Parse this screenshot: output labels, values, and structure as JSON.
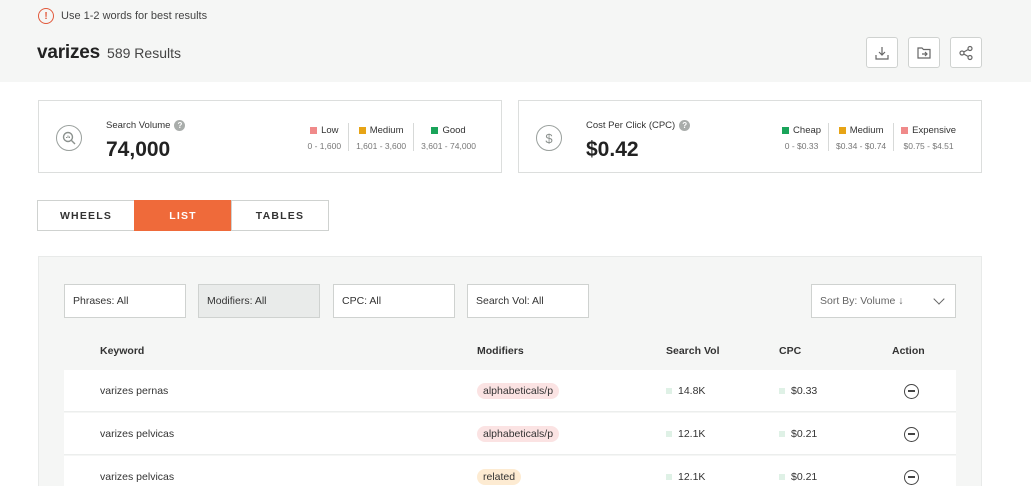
{
  "hint": {
    "text": "Use 1-2 words for best results"
  },
  "header": {
    "keyword": "varizes",
    "results": "589 Results"
  },
  "toolbar": {
    "download": "download-icon",
    "save": "folder-icon",
    "share": "share-icon"
  },
  "cards": {
    "search_volume": {
      "label": "Search Volume",
      "value": "74,000",
      "legend": [
        {
          "name": "Low",
          "range": "0 - 1,600",
          "color": "#f08a8a"
        },
        {
          "name": "Medium",
          "range": "1,601 - 3,600",
          "color": "#e7a416"
        },
        {
          "name": "Good",
          "range": "3,601 - 74,000",
          "color": "#1aa45a"
        }
      ]
    },
    "cpc": {
      "label": "Cost Per Click (CPC)",
      "value": "$0.42",
      "legend": [
        {
          "name": "Cheap",
          "range": "0 - $0.33",
          "color": "#1aa45a"
        },
        {
          "name": "Medium",
          "range": "$0.34 - $0.74",
          "color": "#e7a416"
        },
        {
          "name": "Expensive",
          "range": "$0.75 - $4.51",
          "color": "#f08a8a"
        }
      ]
    }
  },
  "view_tabs": [
    "WHEELS",
    "LIST",
    "TABLES"
  ],
  "filters": {
    "phrases": "Phrases: All",
    "modifiers": "Modifiers: All",
    "cpc": "CPC: All",
    "search_vol": "Search Vol: All",
    "sort": "Sort By: Volume ↓"
  },
  "table": {
    "headers": [
      "Keyword",
      "Modifiers",
      "Search Vol",
      "CPC",
      "Action"
    ],
    "rows": [
      {
        "keyword": "varizes pernas",
        "modifier": "alphabeticals/p",
        "search_vol": "14.8K",
        "cpc": "$0.33"
      },
      {
        "keyword": "varizes pelvicas",
        "modifier": "alphabeticals/p",
        "search_vol": "12.1K",
        "cpc": "$0.21"
      },
      {
        "keyword": "varizes pelvicas",
        "modifier": "related",
        "search_vol": "12.1K",
        "cpc": "$0.21"
      }
    ]
  },
  "colors": {
    "accent": "#ef6a3a",
    "pill_alpha": "#fbe3e3",
    "pill_related": "#fdebd2"
  }
}
